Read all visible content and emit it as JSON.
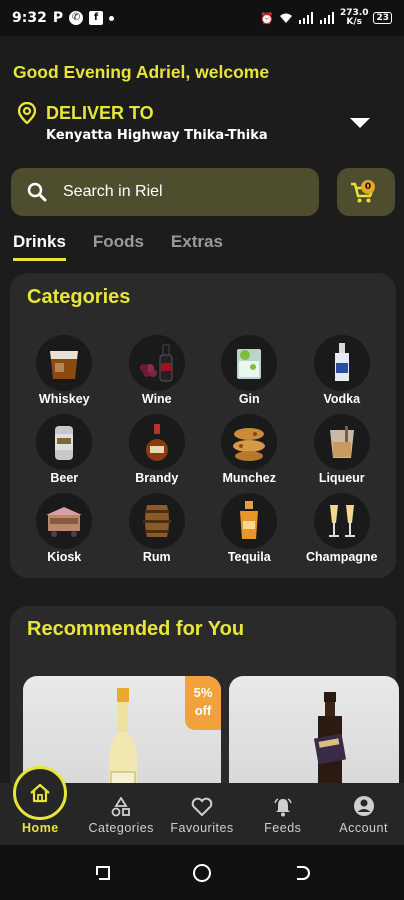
{
  "status_bar": {
    "time": "9:32",
    "p_label": "P",
    "net_speed": "273.0",
    "net_unit": "K/s",
    "battery": "23"
  },
  "header": {
    "greeting": "Good Evening Adriel, welcome",
    "deliver_label": "DELIVER TO",
    "address": "Kenyatta Highway Thika-Thika"
  },
  "search": {
    "placeholder": "Search in Riel"
  },
  "cart": {
    "count": "0"
  },
  "tabs": [
    {
      "label": "Drinks",
      "active": true
    },
    {
      "label": "Foods"
    },
    {
      "label": "Extras"
    }
  ],
  "categories": {
    "title": "Categories",
    "items": [
      {
        "label": "Whiskey"
      },
      {
        "label": "Wine"
      },
      {
        "label": "Gin"
      },
      {
        "label": "Vodka"
      },
      {
        "label": "Beer"
      },
      {
        "label": "Brandy"
      },
      {
        "label": "Munchez"
      },
      {
        "label": "Liqueur"
      },
      {
        "label": "Kiosk"
      },
      {
        "label": "Rum"
      },
      {
        "label": "Tequila"
      },
      {
        "label": "Champagne"
      }
    ]
  },
  "recommended": {
    "title": "Recommended for You",
    "discount_pct": "5%",
    "discount_word": "off"
  },
  "bottom_nav": [
    {
      "label": "Home"
    },
    {
      "label": "Categories"
    },
    {
      "label": "Favourites"
    },
    {
      "label": "Feeds"
    },
    {
      "label": "Account"
    }
  ],
  "colors": {
    "accent": "#e7e53a",
    "background": "#1c1c1c",
    "card": "#2a2a2a",
    "badge": "#f2a23a"
  }
}
